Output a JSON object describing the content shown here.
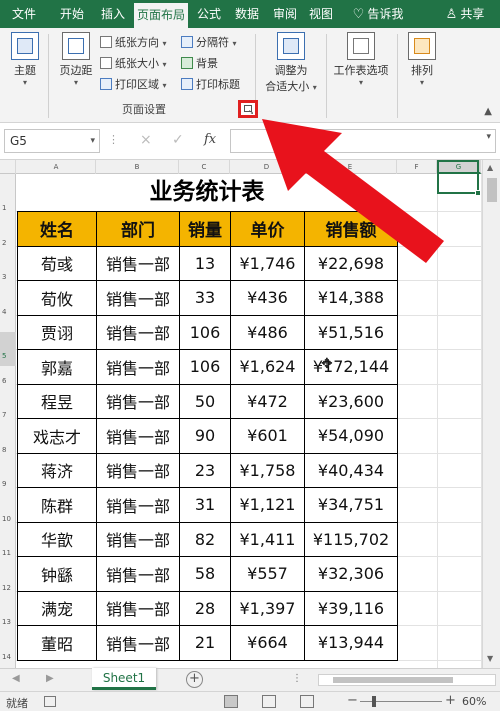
{
  "ribbon_tabs": [
    "文件",
    "开始",
    "插入",
    "页面布局",
    "公式",
    "数据",
    "审阅",
    "视图",
    "告诉我",
    "共享"
  ],
  "ribbon": {
    "themes": "主题",
    "margins": "页边距",
    "orientation": "纸张方向",
    "size": "纸张大小",
    "print_area": "打印区域",
    "breaks": "分隔符",
    "background": "背景",
    "print_titles": "打印标题",
    "group_page_setup": "页面设置",
    "scale_to_fit_line1": "调整为",
    "scale_to_fit_line2": "合适大小",
    "sheet_options": "工作表选项",
    "arrange": "排列",
    "launcher_highlight_color": "#e02020"
  },
  "formula_bar": {
    "name_box": "G5",
    "cancel": "×",
    "enter": "✓",
    "fx": "fx",
    "value": ""
  },
  "columns": [
    "A",
    "B",
    "C",
    "D",
    "E",
    "F",
    "G"
  ],
  "rows": [
    "1",
    "2",
    "3",
    "4",
    "5",
    "6",
    "7",
    "8",
    "9",
    "10",
    "11",
    "12",
    "13",
    "14"
  ],
  "selected_column": "G",
  "selected_row": "5",
  "sheet": {
    "title": "业务统计表",
    "headers": [
      "姓名",
      "部门",
      "销量",
      "单价",
      "销售额"
    ],
    "header_color": "#f4b400",
    "rows": [
      [
        "荀彧",
        "销售一部",
        "13",
        "¥1,746",
        "¥22,698"
      ],
      [
        "荀攸",
        "销售一部",
        "33",
        "¥436",
        "¥14,388"
      ],
      [
        "贾诩",
        "销售一部",
        "106",
        "¥486",
        "¥51,516"
      ],
      [
        "郭嘉",
        "销售一部",
        "106",
        "¥1,624",
        "¥172,144"
      ],
      [
        "程昱",
        "销售一部",
        "50",
        "¥472",
        "¥23,600"
      ],
      [
        "戏志才",
        "销售一部",
        "90",
        "¥601",
        "¥54,090"
      ],
      [
        "蒋济",
        "销售一部",
        "23",
        "¥1,758",
        "¥40,434"
      ],
      [
        "陈群",
        "销售一部",
        "31",
        "¥1,121",
        "¥34,751"
      ],
      [
        "华歆",
        "销售一部",
        "82",
        "¥1,411",
        "¥115,702"
      ],
      [
        "钟繇",
        "销售一部",
        "58",
        "¥557",
        "¥32,306"
      ],
      [
        "满宠",
        "销售一部",
        "28",
        "¥1,397",
        "¥39,116"
      ],
      [
        "董昭",
        "销售一部",
        "21",
        "¥664",
        "¥13,944"
      ]
    ]
  },
  "sheet_tabs": [
    "Sheet1"
  ],
  "status": {
    "ready": "就绪",
    "zoom": "60%"
  },
  "colors": {
    "excel_green": "#217346",
    "arrow_red": "#e8121c"
  }
}
